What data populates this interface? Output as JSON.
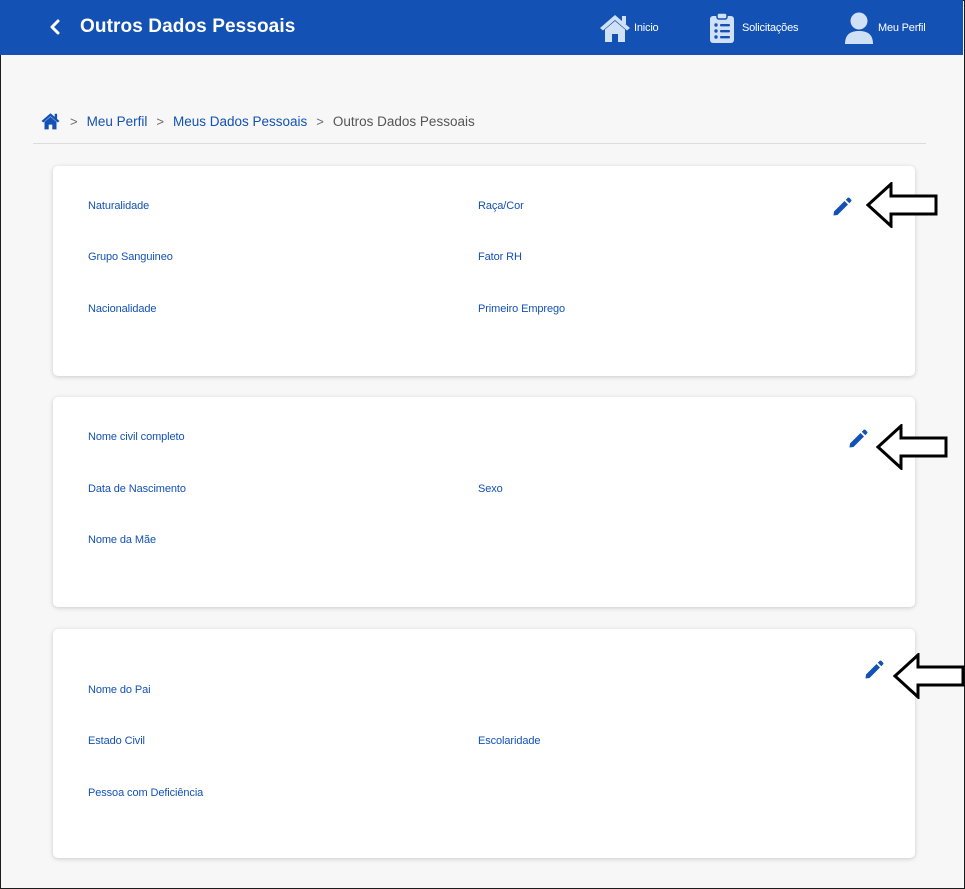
{
  "header": {
    "title": "Outros Dados Pessoais",
    "nav": {
      "home_label": "Inicio",
      "requests_label": "Solicitações",
      "profile_label": "Meu Perfil"
    }
  },
  "breadcrumb": {
    "items": [
      "Meu Perfil",
      "Meus Dados Pessoais"
    ],
    "current": "Outros Dados Pessoais",
    "separator": ">"
  },
  "cards": [
    {
      "fields": {
        "naturalidade": "Naturalidade",
        "raca_cor": "Raça/Cor",
        "grupo_sanguineo": "Grupo Sanguineo",
        "fator_rh": "Fator RH",
        "nacionalidade": "Nacionalidade",
        "primeiro_emprego": "Primeiro Emprego"
      }
    },
    {
      "fields": {
        "nome_civil": "Nome civil completo",
        "data_nascimento": "Data de Nascimento",
        "sexo": "Sexo",
        "nome_mae": "Nome da Mãe"
      }
    },
    {
      "fields": {
        "nome_pai": "Nome do Pai",
        "estado_civil": "Estado Civil",
        "escolaridade": "Escolaridade",
        "pcd": "Pessoa com Deficiência"
      }
    }
  ],
  "icons": {
    "back": "chevron-left-icon",
    "home": "home-icon",
    "requests": "clipboard-list-icon",
    "profile": "user-icon",
    "edit": "pencil-icon",
    "annotation": "arrow-left-outline-icon"
  },
  "colors": {
    "primary": "#1351b4",
    "page_background": "#f7f7f7",
    "card_background": "#ffffff",
    "breadcrumb_current": "#555555"
  }
}
